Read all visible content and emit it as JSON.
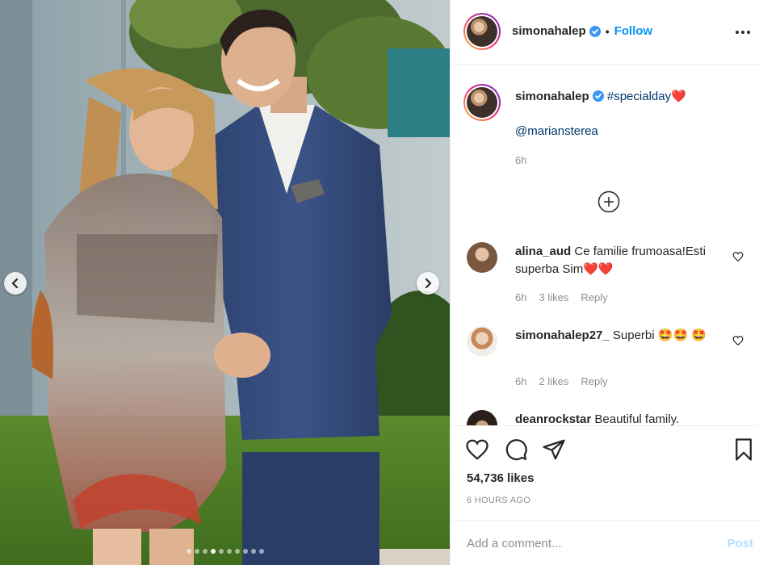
{
  "post": {
    "username": "simonahalep",
    "follow_label": "Follow",
    "separator": "•",
    "caption_hashtag": "#specialday",
    "caption_emoji": "❤️",
    "caption_mention": "@mariansterea",
    "caption_time": "6h",
    "likes": "54,736 likes",
    "posted_ago": "6 HOURS AGO",
    "carousel": {
      "total_slides": 10,
      "active_slide": 4
    }
  },
  "comments": [
    {
      "username": "alina_aud",
      "text": "Ce familie frumoasa!Esti superba Sim",
      "emojis": "❤️❤️",
      "time": "6h",
      "likes": "3 likes",
      "reply": "Reply"
    },
    {
      "username": "simonahalep27_",
      "text": "Superbi",
      "emojis": "🤩🤩 🤩",
      "time": "6h",
      "likes": "2 likes",
      "reply": "Reply"
    },
    {
      "username": "deanrockstar",
      "text": "Beautiful family."
    }
  ],
  "add_comment": {
    "placeholder": "Add a comment...",
    "post_label": "Post"
  },
  "colors": {
    "link_blue": "#0095f6",
    "hashtag_blue": "#00376b",
    "muted": "#8e8e8e",
    "heart_red": "#ed4956"
  },
  "icons": [
    "more-options-icon",
    "verified-badge-icon",
    "load-more-icon",
    "heart-icon",
    "comment-icon",
    "share-icon",
    "bookmark-icon",
    "chevron-left-icon",
    "chevron-right-icon"
  ]
}
